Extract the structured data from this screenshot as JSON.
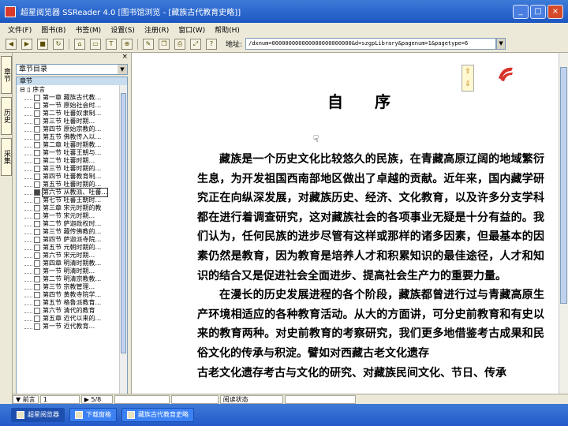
{
  "window": {
    "title": "超星阅览器 SSReader 4.0 [图书馆浏览 - [藏族古代教育史略]]"
  },
  "menu": [
    "文件(F)",
    "图书(B)",
    "书签(M)",
    "设置(S)",
    "注册(R)",
    "窗口(W)",
    "帮助(H)"
  ],
  "toolbar": {
    "icons": [
      "back-icon",
      "forward-icon",
      "stop-icon",
      "refresh-icon",
      "home-icon",
      "select-text-icon",
      "text-icon",
      "zoom-icon",
      "highlight-icon",
      "bookmark-icon",
      "print-icon",
      "fit-icon",
      "help-icon"
    ],
    "address_label": "地址:",
    "address_value": "/dxnum=000000000000000000000000&d=szgpLibrary&pagenum=1&pagetype=6"
  },
  "vertical_tabs": [
    "章节",
    "历史",
    "采集"
  ],
  "side": {
    "close": "×",
    "selector": "章节目录",
    "tree_header": "章节",
    "root": "序言",
    "items": [
      "第一章 藏族古代教...",
      "第一节 原始社会时...",
      "第二节 吐蕃奴隶制...",
      "第三节 吐蕃时期...",
      "第四节 原始宗教的...",
      "第五节 佛教传入以...",
      "第二章 吐蕃时期教...",
      "第一节 吐蕃王朝与...",
      "第二节 吐蕃时期...",
      "第三节 吐蕃时期的...",
      "第四节 吐蕃教育制...",
      "第五节 吐蕃时期的...",
      "第六节 从教派、吐蕃...",
      "第七节 吐蕃王朝时...",
      "第三章 宋元时期的教",
      "第一节 宋元时期...",
      "第二节 萨迦政权时...",
      "第三节 藏传佛教的...",
      "第四节 萨迦派寺院...",
      "第五节 元朝时期的...",
      "第六节 宋元时期...",
      "第四章 明清时期教...",
      "第一节 明清时期...",
      "第二节 明清宗教教...",
      "第三节 宗教管理...",
      "第四节 黄教寺院学...",
      "第五节 格鲁派教育...",
      "第六节 清代的教育",
      "第五章 近代以来的...",
      "第一节 近代教育..."
    ],
    "selected_index": 12
  },
  "document": {
    "title": "自序",
    "paragraphs": [
      "藏族是一个历史文化比较悠久的民族，在青藏高原辽阔的地域繁衍生息，为开发祖国西南部地区做出了卓越的贡献。近年来，国内藏学研究正在向纵深发展，对藏族历史、经济、文化教育，以及许多分支学科都在进行着调查研究，这对藏族社会的各项事业无疑是十分有益的。我们认为，任何民族的进步尽管有这样或那样的诸多因素，但最基本的因素仍然是教育，因为教育是培养人才和积累知识的最佳途径，人才和知识的结合又是促进社会全面进步、提高社会生产力的重要力量。",
      "在漫长的历史发展进程的各个阶段，藏族都曾进行过与青藏高原生产环境相适应的各种教育活动。从大的方面讲，可分史前教育和有史以来的教育两种。对史前教育的考察研究，我们更多地借鉴考古成果和民俗文化的传承与积淀。譬如对西藏古老文化遗存",
      "古老文化遗存考古与文化的研究、对藏族民间文化、节日、传承"
    ]
  },
  "status": {
    "cells": [
      "▼ 前言",
      "1",
      "▶ 5/8",
      "",
      "",
      "阅读状态",
      ""
    ]
  },
  "taskbar": [
    "超星阅览器",
    "下载窗格",
    "藏族古代教育史略"
  ]
}
